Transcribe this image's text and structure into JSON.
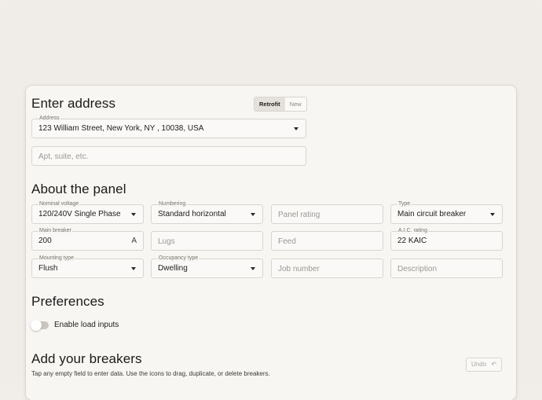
{
  "address_section": {
    "title": "Enter address",
    "mode_options": [
      "Retrofit",
      "New"
    ],
    "address_label": "Address",
    "address_value": "123 William Street, New York, NY , 10038, USA",
    "apt_placeholder": "Apt, suite, etc."
  },
  "panel_section": {
    "title": "About the panel",
    "nominal_voltage": {
      "label": "Nominal voltage",
      "value": "120/240V Single Phase"
    },
    "numbering": {
      "label": "Numbering",
      "value": "Standard horizontal"
    },
    "panel_rating": {
      "placeholder": "Panel rating"
    },
    "type": {
      "label": "Type",
      "value": "Main circuit breaker"
    },
    "main_breaker": {
      "label": "Main breaker",
      "value": "200",
      "unit": "A"
    },
    "lugs": {
      "placeholder": "Lugs"
    },
    "feed": {
      "placeholder": "Feed"
    },
    "aic_rating": {
      "label": "A.I.C. rating",
      "value": "22 KAIC"
    },
    "mounting_type": {
      "label": "Mounting type",
      "value": "Flush"
    },
    "occupancy_type": {
      "label": "Occupancy type",
      "value": "Dwelling"
    },
    "job_number": {
      "placeholder": "Job number"
    },
    "description": {
      "placeholder": "Description"
    }
  },
  "preferences_section": {
    "title": "Preferences",
    "load_inputs_label": "Enable load inputs",
    "load_inputs_enabled": false
  },
  "breakers_section": {
    "title": "Add your breakers",
    "hint": "Tap any empty field to enter data. Use the icons to drag, duplicate, or delete breakers.",
    "undo_label": "Undo",
    "undo_icon": "undo-arrow-icon"
  }
}
